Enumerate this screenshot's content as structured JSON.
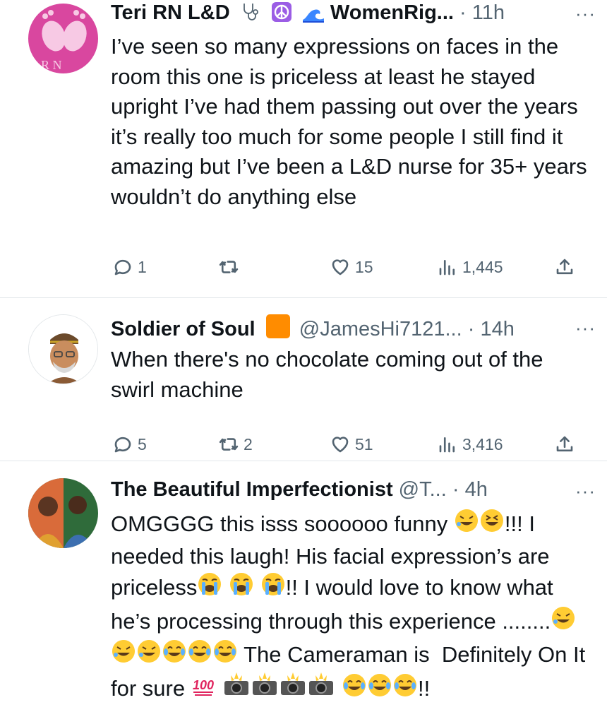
{
  "tweets": [
    {
      "name": "Teri RN L&D",
      "handle": "WomenRig...",
      "dot": "·",
      "time": "11h",
      "text": "I’ve seen so many expressions on faces in the room this one is priceless at least he stayed upright I’ve had them passing out over the years it’s really too much for some people I still find it amazing but I’ve been a L&D nurse for 35+ years wouldn’t do anything else",
      "replies": "1",
      "retweets": "",
      "likes": "15",
      "views": "1,445"
    },
    {
      "name": "Soldier of Soul",
      "handle": "@JamesHi7121...",
      "dot": "·",
      "time": "14h",
      "text": "When there's no chocolate coming out of the swirl machine",
      "replies": "5",
      "retweets": "2",
      "likes": "51",
      "views": "3,416"
    },
    {
      "name": "The Beautiful Imperfectionist",
      "handle": "@T...",
      "dot": "·",
      "time": "4h",
      "text_parts": [
        "OMGGGG this isss soooooo funny",
        "!!! I needed this laugh! His facial expression’s are priceless",
        "!! I would love to know what he’s processing through this experience ........",
        "The Cameraman is  Definitely On It for sure",
        "!!"
      ]
    }
  ],
  "icons": {
    "more": "more-horizontal-icon",
    "reply": "reply-icon",
    "retweet": "retweet-icon",
    "like": "heart-icon",
    "views": "views-icon",
    "share": "share-icon"
  },
  "colors": {
    "text": "#0f1419",
    "secondary": "#536471",
    "divider": "#e3e7ea",
    "orange": "#ff8c00"
  },
  "more_label": "···"
}
